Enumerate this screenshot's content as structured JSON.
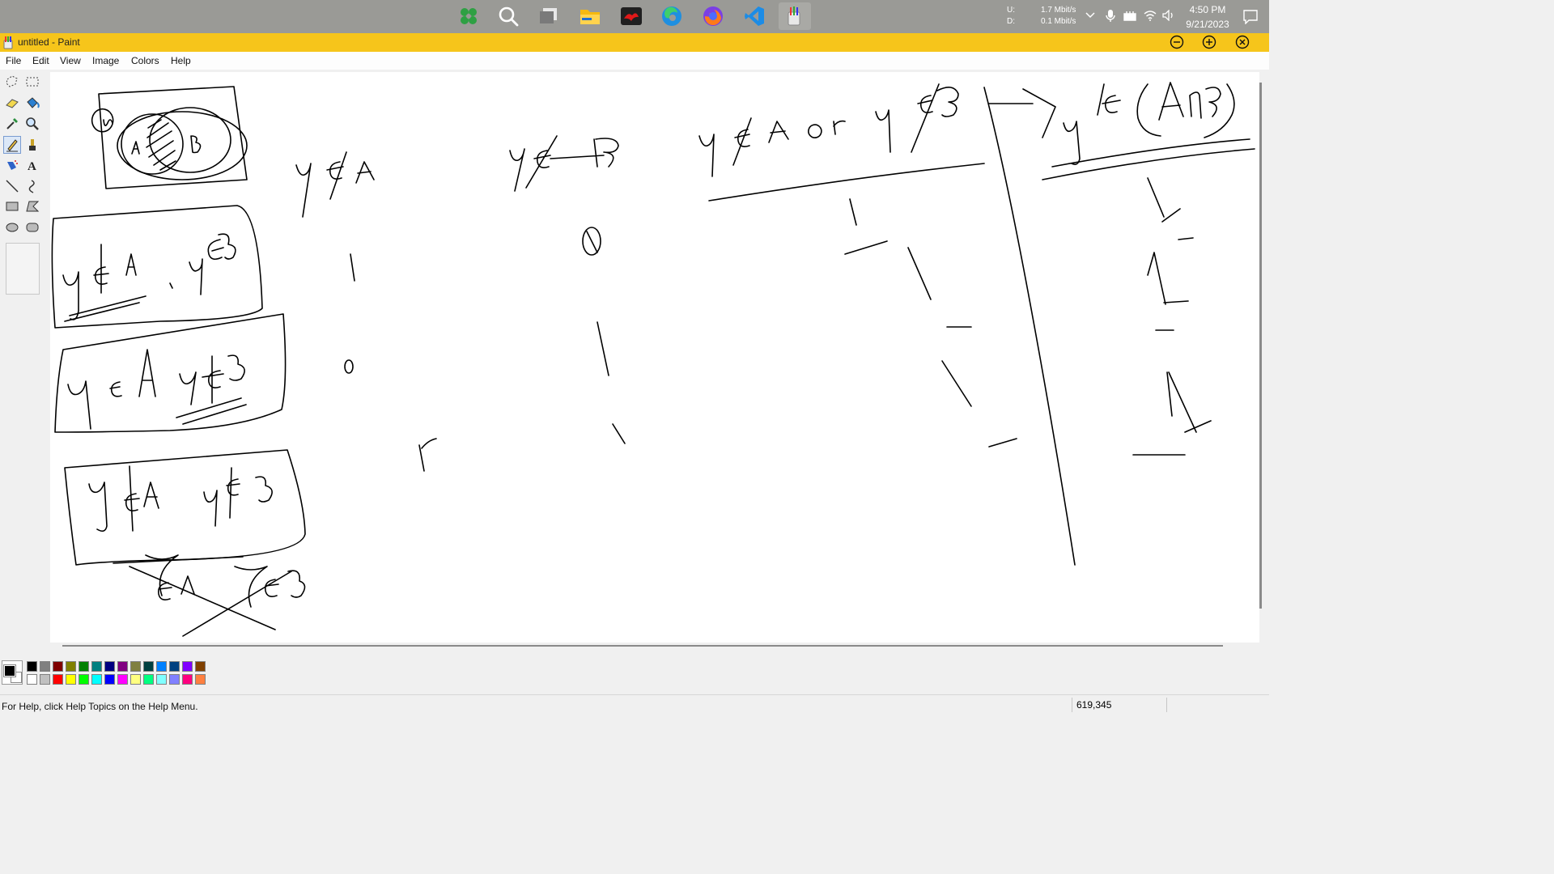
{
  "taskbar": {
    "apps": [
      {
        "name": "start",
        "icon": "start-icon"
      },
      {
        "name": "search",
        "icon": "search-icon"
      },
      {
        "name": "task-view",
        "icon": "task-view-icon"
      },
      {
        "name": "file-explorer",
        "icon": "folder-icon"
      },
      {
        "name": "game-app",
        "icon": "game-app-icon"
      },
      {
        "name": "edge",
        "icon": "edge-icon"
      },
      {
        "name": "firefox",
        "icon": "firefox-icon"
      },
      {
        "name": "vscode",
        "icon": "vscode-icon"
      },
      {
        "name": "paint",
        "icon": "paint-icon",
        "active": true
      }
    ],
    "network": {
      "upload_label": "U:",
      "upload_value": "1.7 Mbit/s",
      "download_label": "D:",
      "download_value": "0.1 Mbit/s"
    },
    "time": "4:50 PM",
    "date": "9/21/2023"
  },
  "window": {
    "title": "untitled - Paint",
    "title_bar_color": "#f6c51b"
  },
  "menu": [
    "File",
    "Edit",
    "View",
    "Image",
    "Colors",
    "Help"
  ],
  "tools": [
    {
      "name": "free-form-select",
      "icon": "free-select-icon"
    },
    {
      "name": "select",
      "icon": "rect-select-icon"
    },
    {
      "name": "eraser",
      "icon": "eraser-icon"
    },
    {
      "name": "fill",
      "icon": "fill-bucket-icon"
    },
    {
      "name": "pick-color",
      "icon": "eyedropper-icon"
    },
    {
      "name": "magnifier",
      "icon": "magnifier-icon"
    },
    {
      "name": "pencil",
      "icon": "pencil-icon",
      "active": true
    },
    {
      "name": "brush",
      "icon": "brush-icon"
    },
    {
      "name": "airbrush",
      "icon": "airbrush-icon"
    },
    {
      "name": "text",
      "icon": "text-icon"
    },
    {
      "name": "line",
      "icon": "line-icon"
    },
    {
      "name": "curve",
      "icon": "curve-icon"
    },
    {
      "name": "rectangle",
      "icon": "rectangle-icon"
    },
    {
      "name": "polygon",
      "icon": "polygon-icon"
    },
    {
      "name": "ellipse",
      "icon": "ellipse-icon"
    },
    {
      "name": "rounded-rectangle",
      "icon": "rounded-rect-icon"
    }
  ],
  "palette": {
    "foreground": "#000000",
    "background": "#ffffff",
    "top_row": [
      "#000000",
      "#808080",
      "#800000",
      "#808000",
      "#008000",
      "#008080",
      "#000080",
      "#800080",
      "#808040",
      "#004040",
      "#0080ff",
      "#004080",
      "#8000ff",
      "#804000"
    ],
    "bottom_row": [
      "#ffffff",
      "#c0c0c0",
      "#ff0000",
      "#ffff00",
      "#00ff00",
      "#00ffff",
      "#0000ff",
      "#ff00ff",
      "#ffff80",
      "#00ff80",
      "#80ffff",
      "#8080ff",
      "#ff0080",
      "#ff8040"
    ]
  },
  "canvas": {
    "handwriting": {
      "venn_labels": [
        "U",
        "A",
        "B"
      ],
      "box1": "y∉A , y∈B",
      "box2": "y∈A y∉B",
      "box3": "y∉A y∉B",
      "struck_text": "x∈A x∈B",
      "col1_header": "y∉A",
      "col1_values": [
        "1",
        "0",
        "r"
      ],
      "col2_header": "y∉B",
      "col2_values": [
        "0",
        "1",
        "1"
      ],
      "col3_header": "y∉A or y∉B",
      "col3_values": [
        "1",
        "1",
        "1"
      ],
      "col4_header": "y∉(A∩B)",
      "col4_values": [
        "1",
        "1",
        "1"
      ]
    }
  },
  "status": {
    "help_text": "For Help, click Help Topics on the Help Menu.",
    "coordinates": "619,345"
  }
}
